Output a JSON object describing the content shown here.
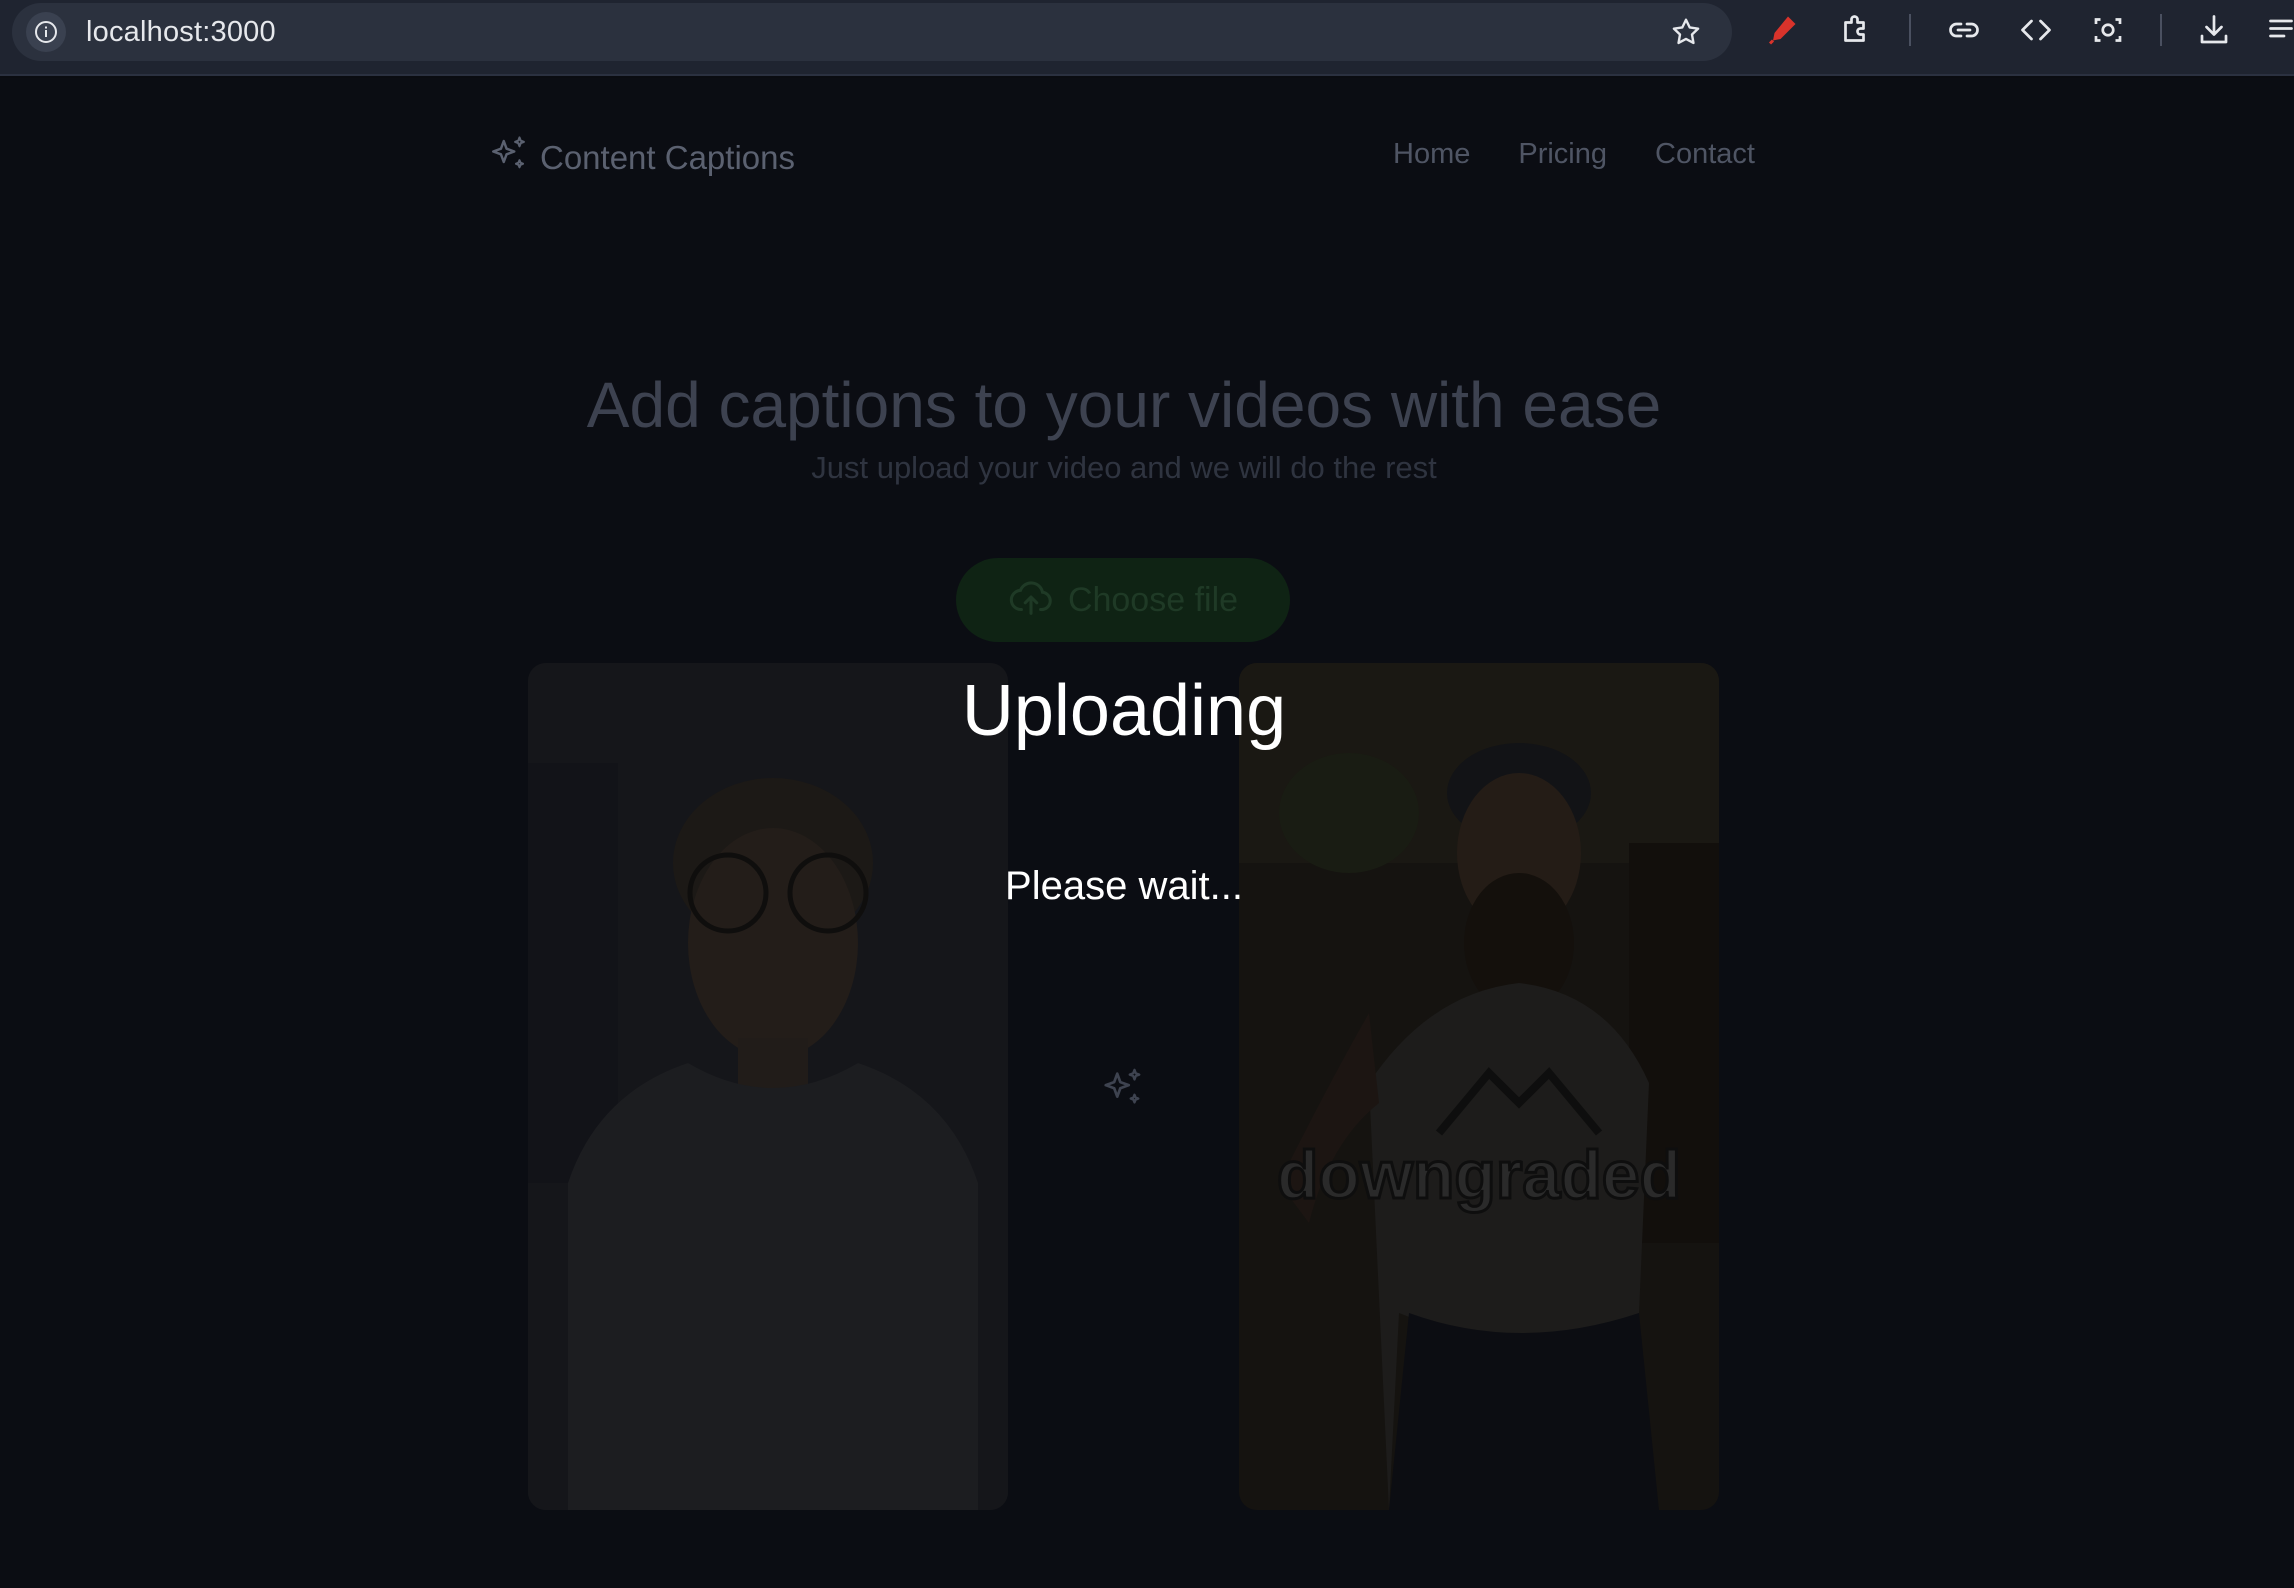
{
  "browser": {
    "url": "localhost:3000",
    "icons": [
      "info-icon",
      "star-icon",
      "marker-icon",
      "extensions-icon",
      "link-icon",
      "code-icon",
      "screenshot-icon",
      "download-icon",
      "reading-list-icon"
    ]
  },
  "nav": {
    "logo_text": "Content Captions",
    "links": [
      "Home",
      "Pricing",
      "Contact"
    ]
  },
  "hero": {
    "title": "Add captions to your videos with ease",
    "subtitle": "Just upload your video and we will do the rest",
    "choose_file_label": "Choose file"
  },
  "demo": {
    "caption_word": "downgraded"
  },
  "overlay": {
    "title": "Uploading",
    "subtitle": "Please wait..."
  },
  "colors": {
    "accent_green": "#16a34a",
    "marker_red": "#d9332b"
  }
}
